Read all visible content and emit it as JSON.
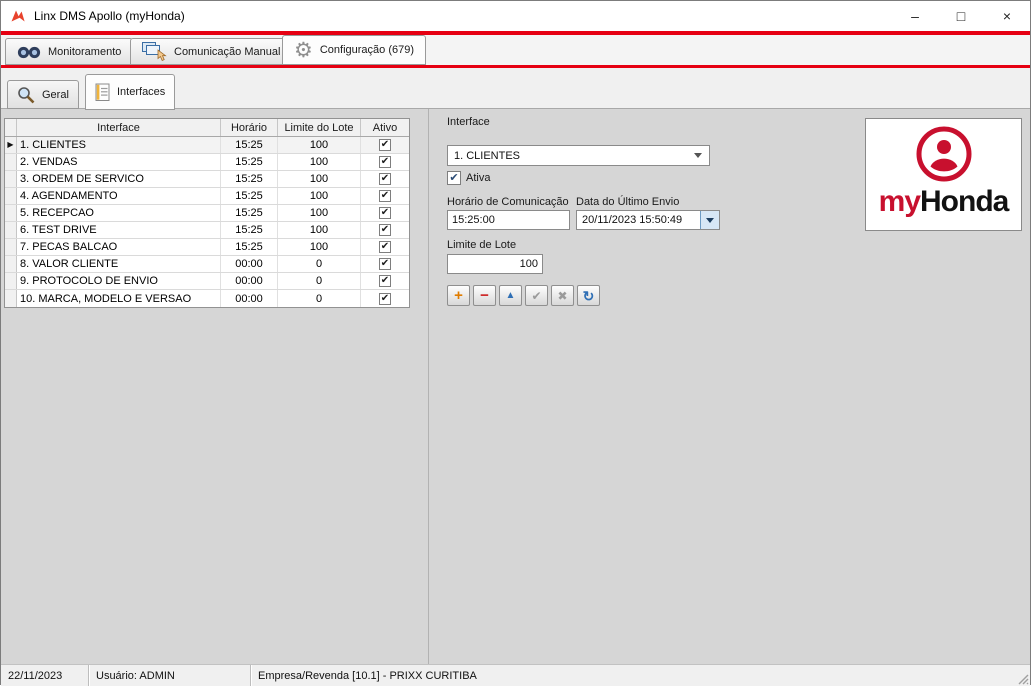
{
  "colors": {
    "accent_red": "#e60012",
    "logo_red": "#c8102e",
    "selection_blue": "#2f6fb5"
  },
  "window": {
    "title": "Linx DMS Apollo (myHonda)",
    "minimize": "–",
    "maximize": "□",
    "close": "×"
  },
  "icons": {
    "gear": "⚙",
    "row_marker": "▶",
    "check": "✔"
  },
  "main_tabs": [
    {
      "label": "Monitoramento",
      "icon": "binoculars-icon",
      "active": false
    },
    {
      "label": "Comunicação Manual",
      "icon": "monitor-hand-icon",
      "active": false
    },
    {
      "label": "Configuração (679)",
      "icon": "gear-icon",
      "active": true
    }
  ],
  "sub_tabs": [
    {
      "label": "Geral",
      "icon": "magnifier-icon",
      "active": false
    },
    {
      "label": "Interfaces",
      "icon": "document-icon",
      "active": true
    }
  ],
  "grid": {
    "columns": [
      "Interface",
      "Horário",
      "Limite do Lote",
      "Ativo"
    ],
    "rows": [
      {
        "interface": "1. CLIENTES",
        "horario": "15:25",
        "limite": "100",
        "ativo": true,
        "selected": true
      },
      {
        "interface": "2. VENDAS",
        "horario": "15:25",
        "limite": "100",
        "ativo": true,
        "selected": false
      },
      {
        "interface": "3. ORDEM DE SERVICO",
        "horario": "15:25",
        "limite": "100",
        "ativo": true,
        "selected": false
      },
      {
        "interface": "4. AGENDAMENTO",
        "horario": "15:25",
        "limite": "100",
        "ativo": true,
        "selected": false
      },
      {
        "interface": "5. RECEPCAO",
        "horario": "15:25",
        "limite": "100",
        "ativo": true,
        "selected": false
      },
      {
        "interface": "6. TEST DRIVE",
        "horario": "15:25",
        "limite": "100",
        "ativo": true,
        "selected": false
      },
      {
        "interface": "7. PECAS BALCAO",
        "horario": "15:25",
        "limite": "100",
        "ativo": true,
        "selected": false
      },
      {
        "interface": "8. VALOR CLIENTE",
        "horario": "00:00",
        "limite": "0",
        "ativo": true,
        "selected": false
      },
      {
        "interface": "9. PROTOCOLO DE ENVIO",
        "horario": "00:00",
        "limite": "0",
        "ativo": true,
        "selected": false
      },
      {
        "interface": "10. MARCA, MODELO E VERSAO",
        "horario": "00:00",
        "limite": "0",
        "ativo": true,
        "selected": false
      }
    ]
  },
  "form": {
    "interface_label": "Interface",
    "interface_value": "1. CLIENTES",
    "ativa_label": "Ativa",
    "ativa_checked": true,
    "horario_label": "Horário de Comunicação",
    "horario_value": "15:25:00",
    "data_envio_label": "Data do Último Envio",
    "data_envio_value": "20/11/2023 15:50:49",
    "limite_label": "Limite de Lote",
    "limite_value": "100",
    "toolbar": [
      {
        "name": "add",
        "glyph": "+"
      },
      {
        "name": "remove",
        "glyph": "−"
      },
      {
        "name": "move-up",
        "glyph": "▲"
      },
      {
        "name": "confirm",
        "glyph": "✔"
      },
      {
        "name": "cancel",
        "glyph": "✖"
      },
      {
        "name": "refresh",
        "glyph": "↻"
      }
    ]
  },
  "logo": {
    "my": "my",
    "honda": "Honda"
  },
  "status_bar": {
    "date": "22/11/2023",
    "user": "Usuário: ADMIN",
    "company": "Empresa/Revenda [10.1] - PRIXX CURITIBA"
  }
}
